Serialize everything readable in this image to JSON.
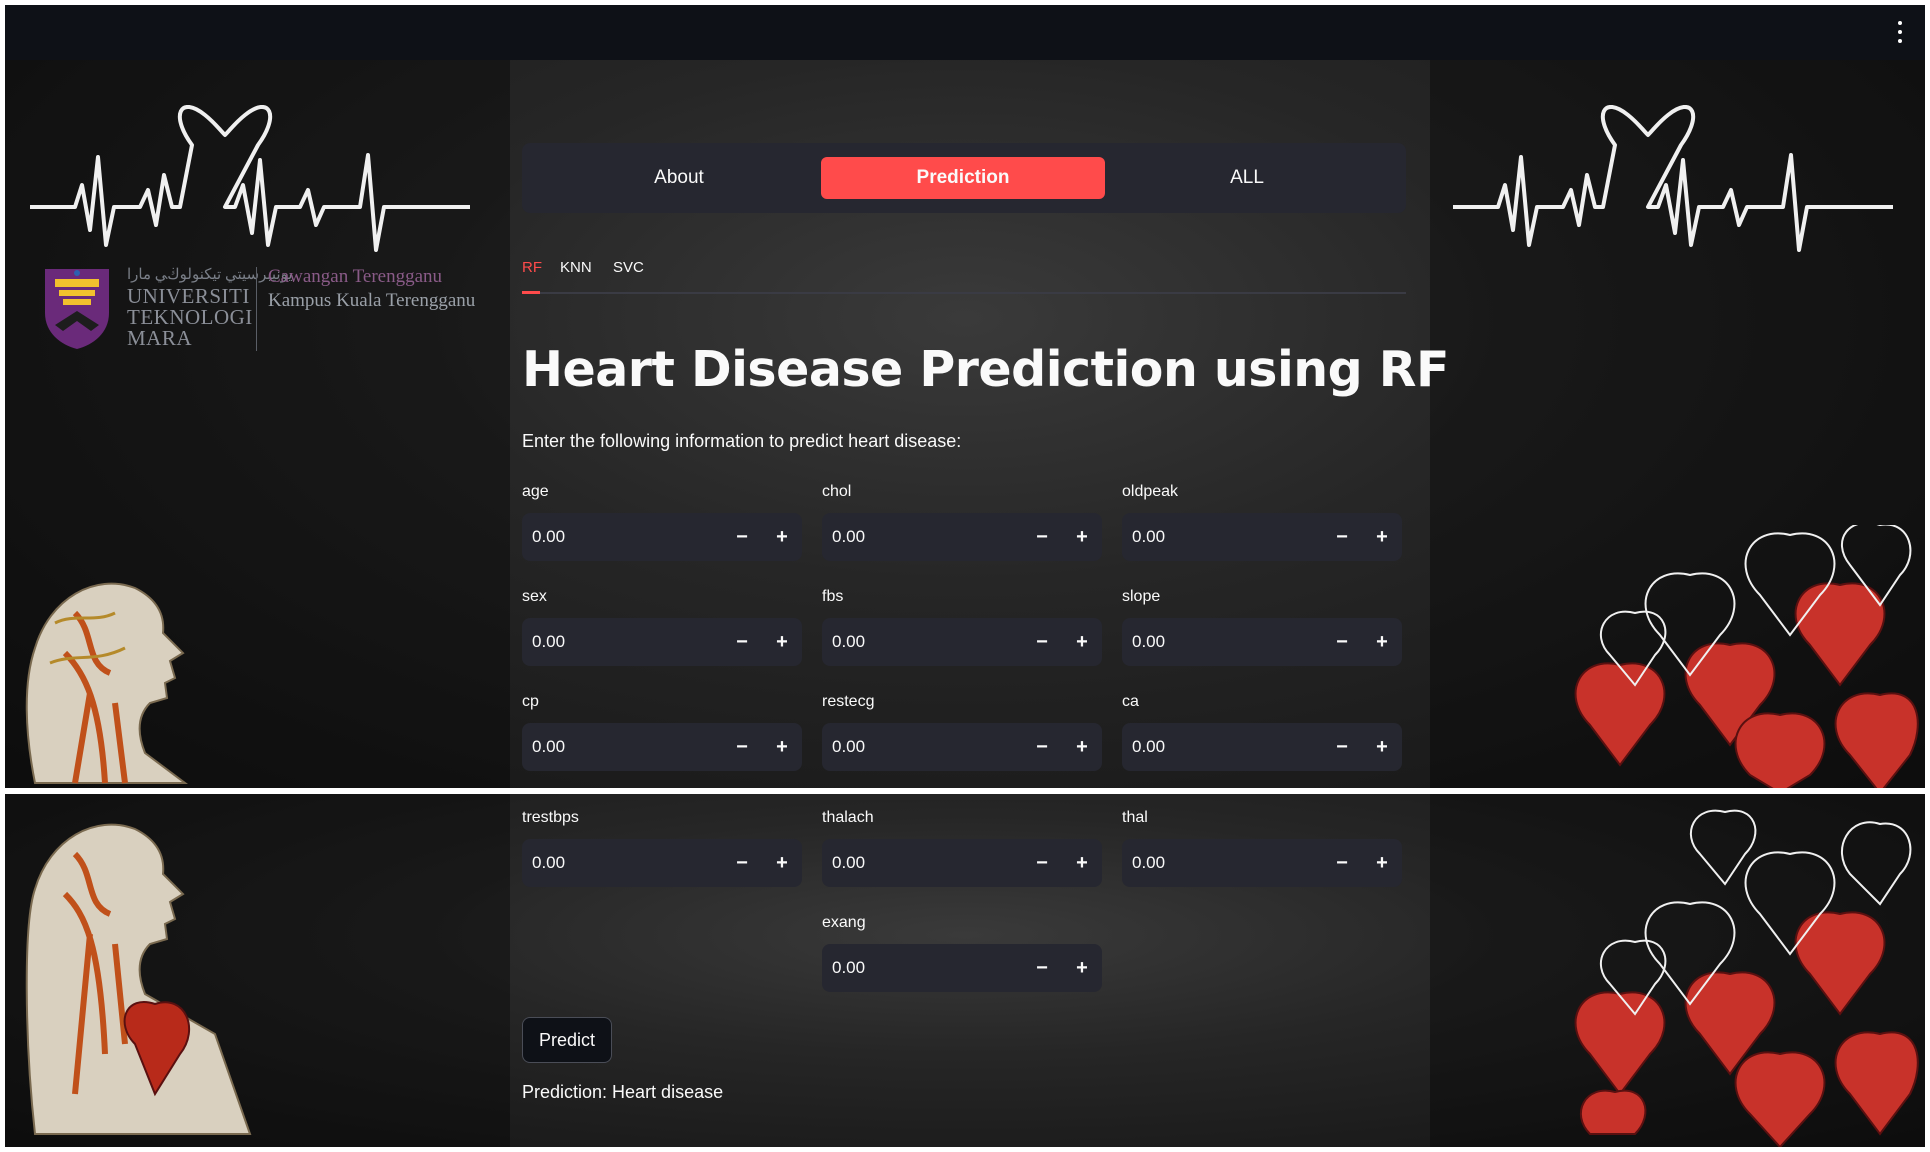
{
  "nav": {
    "tabs": [
      {
        "label": "About",
        "active": false
      },
      {
        "label": "Prediction",
        "active": true
      },
      {
        "label": "ALL",
        "active": false
      }
    ]
  },
  "subtabs": [
    {
      "label": "RF",
      "active": true
    },
    {
      "label": "KNN",
      "active": false
    },
    {
      "label": "SVC",
      "active": false
    }
  ],
  "page": {
    "title": "Heart Disease Prediction using RF",
    "intro": "Enter the following information to predict heart disease:"
  },
  "logo": {
    "jawi": "ﯾﻮﻧﻴﺒﺮﺳﻴﺘﻲ ﺗﻴﻜﻨﻮﻟﻮڬﻲ ﻣﺎرا",
    "line1": "UNIVERSITI",
    "line2": "TEKNOLOGI",
    "line3": "MARA",
    "campus1": "Cawangan Terengganu",
    "campus2": "Kampus Kuala Terengganu"
  },
  "fields": {
    "age": {
      "label": "age",
      "value": "0.00"
    },
    "chol": {
      "label": "chol",
      "value": "0.00"
    },
    "oldpeak": {
      "label": "oldpeak",
      "value": "0.00"
    },
    "sex": {
      "label": "sex",
      "value": "0.00"
    },
    "fbs": {
      "label": "fbs",
      "value": "0.00"
    },
    "slope": {
      "label": "slope",
      "value": "0.00"
    },
    "cp": {
      "label": "cp",
      "value": "0.00"
    },
    "restecg": {
      "label": "restecg",
      "value": "0.00"
    },
    "ca": {
      "label": "ca",
      "value": "0.00"
    },
    "trestbps": {
      "label": "trestbps",
      "value": "0.00"
    },
    "thalach": {
      "label": "thalach",
      "value": "0.00"
    },
    "thal": {
      "label": "thal",
      "value": "0.00"
    },
    "exang": {
      "label": "exang",
      "value": "0.00"
    }
  },
  "stepper": {
    "minus": "−",
    "plus": "+"
  },
  "actions": {
    "predict_label": "Predict"
  },
  "result": {
    "text": "Prediction: Heart disease"
  },
  "colors": {
    "accent": "#ff4b4b",
    "widget_bg": "#262730",
    "topbar": "#0e1117"
  },
  "icons": [
    "kebab-menu-icon",
    "ekg-heart-icon",
    "uitm-crest-icon",
    "anatomy-head-icon",
    "anatomical-hearts-icon"
  ]
}
